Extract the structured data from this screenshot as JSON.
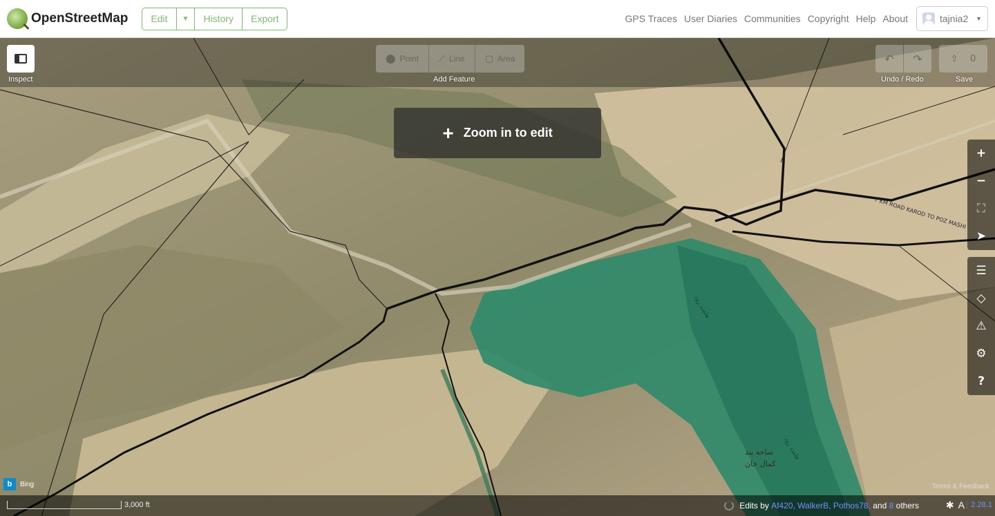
{
  "header": {
    "brand": "OpenStreetMap",
    "edit_label": "Edit",
    "history_label": "History",
    "export_label": "Export",
    "nav": [
      "GPS Traces",
      "User Diaries",
      "Communities",
      "Copyright",
      "Help",
      "About"
    ],
    "username": "tajnia2"
  },
  "toolbar": {
    "inspect_label": "Inspect",
    "point_label": "Point",
    "line_label": "Line",
    "area_label": "Area",
    "add_feature_label": "Add Feature",
    "undo_redo_label": "Undo / Redo",
    "save_label": "Save",
    "save_count": "0"
  },
  "map": {
    "zoom_notice": "Zoom in to edit",
    "road_label": "7 KM ROAD KAROD TO POZ MASHI",
    "water_label_1": "هلمند رود",
    "water_label_2": "هلمند رود",
    "place_label_1": "ساحه بند",
    "place_label_2": "کمال خان",
    "imagery_provider": "Bing",
    "terms_label": "Terms & Feedback"
  },
  "footer": {
    "scale_label": "3,000 ft",
    "edits_by": "Edits by",
    "contributors": [
      "Af420,",
      "WalkerB,",
      "Pothos78,"
    ],
    "and_label": "and",
    "others_count": "8",
    "others_label": "others",
    "version": "2.28.1"
  },
  "colors": {
    "osm_green": "#7ebc6f",
    "link_blue": "#7092ff",
    "water": "#2d8a6a"
  }
}
